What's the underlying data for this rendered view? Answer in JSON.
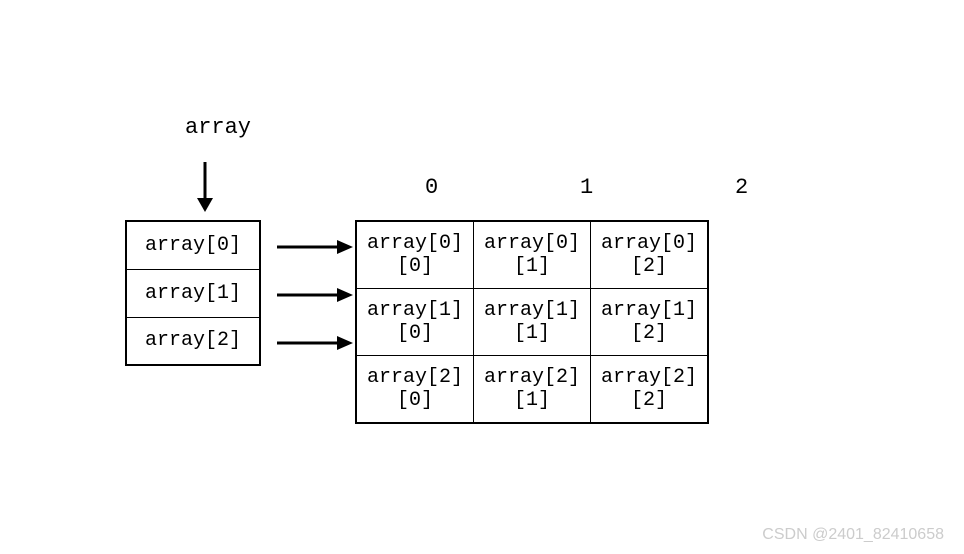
{
  "title": "array",
  "pointer_column": [
    "array[0]",
    "array[1]",
    "array[2]"
  ],
  "column_headers": [
    "0",
    "1",
    "2"
  ],
  "grid": [
    [
      "array[0][0]",
      "array[0][1]",
      "array[0][2]"
    ],
    [
      "array[1][0]",
      "array[1][1]",
      "array[1][2]"
    ],
    [
      "array[2][0]",
      "array[2][1]",
      "array[2][2]"
    ]
  ],
  "watermark": "CSDN @2401_82410658"
}
